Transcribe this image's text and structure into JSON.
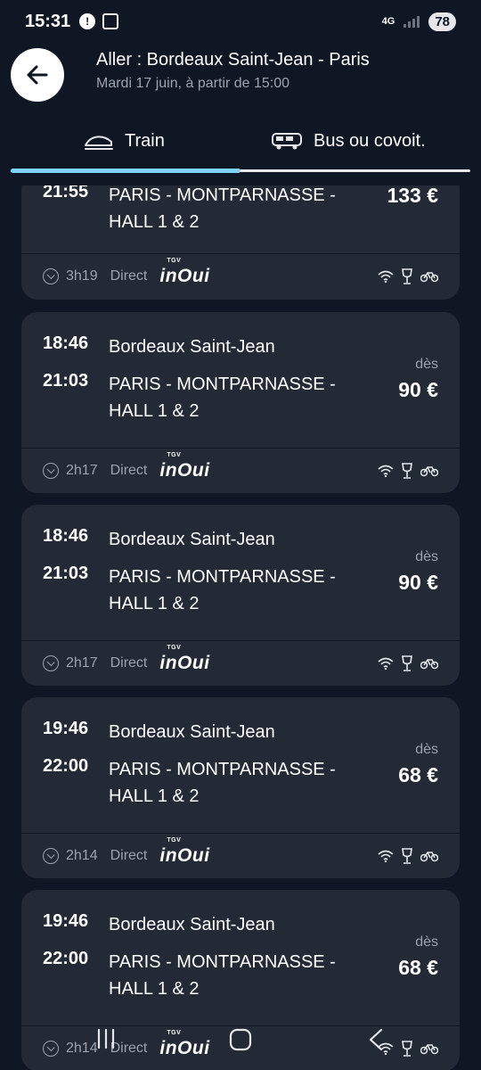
{
  "status": {
    "time": "15:31",
    "network": "4G",
    "battery": "78"
  },
  "header": {
    "title": "Aller : Bordeaux Saint-Jean - Paris",
    "subtitle": "Mardi 17 juin, à partir de 15:00"
  },
  "tabs": [
    {
      "label": "Train",
      "icon": "train-icon",
      "active": true
    },
    {
      "label": "Bus ou covoit.",
      "icon": "bus-icon",
      "active": false
    }
  ],
  "journeys": [
    {
      "depart_time": "",
      "depart_station": "",
      "arrive_time": "21:55",
      "arrive_station": "PARIS - MONTPARNASSE - HALL 1 & 2",
      "price_from": "",
      "price": "133 €",
      "duration": "3h19",
      "type": "Direct",
      "brand": "inOui",
      "brand_sup": "TGV"
    },
    {
      "depart_time": "18:46",
      "depart_station": "Bordeaux Saint-Jean",
      "arrive_time": "21:03",
      "arrive_station": "PARIS - MONTPARNASSE - HALL 1 & 2",
      "price_from": "dès",
      "price": "90 €",
      "duration": "2h17",
      "type": "Direct",
      "brand": "inOui",
      "brand_sup": "TGV"
    },
    {
      "depart_time": "18:46",
      "depart_station": "Bordeaux Saint-Jean",
      "arrive_time": "21:03",
      "arrive_station": "PARIS - MONTPARNASSE - HALL 1 & 2",
      "price_from": "dès",
      "price": "90 €",
      "duration": "2h17",
      "type": "Direct",
      "brand": "inOui",
      "brand_sup": "TGV"
    },
    {
      "depart_time": "19:46",
      "depart_station": "Bordeaux Saint-Jean",
      "arrive_time": "22:00",
      "arrive_station": "PARIS - MONTPARNASSE - HALL 1 & 2",
      "price_from": "dès",
      "price": "68 €",
      "duration": "2h14",
      "type": "Direct",
      "brand": "inOui",
      "brand_sup": "TGV"
    },
    {
      "depart_time": "19:46",
      "depart_station": "Bordeaux Saint-Jean",
      "arrive_time": "22:00",
      "arrive_station": "PARIS - MONTPARNASSE - HALL 1 & 2",
      "price_from": "dès",
      "price": "68 €",
      "duration": "2h14",
      "type": "Direct",
      "brand": "inOui",
      "brand_sup": "TGV"
    }
  ],
  "amenity_icons": [
    "wifi-icon",
    "bar-icon",
    "bike-icon"
  ],
  "colors": {
    "background": "#0f1724",
    "card": "#232a36",
    "accent": "#7dd3fc",
    "muted": "#9ca3af"
  }
}
